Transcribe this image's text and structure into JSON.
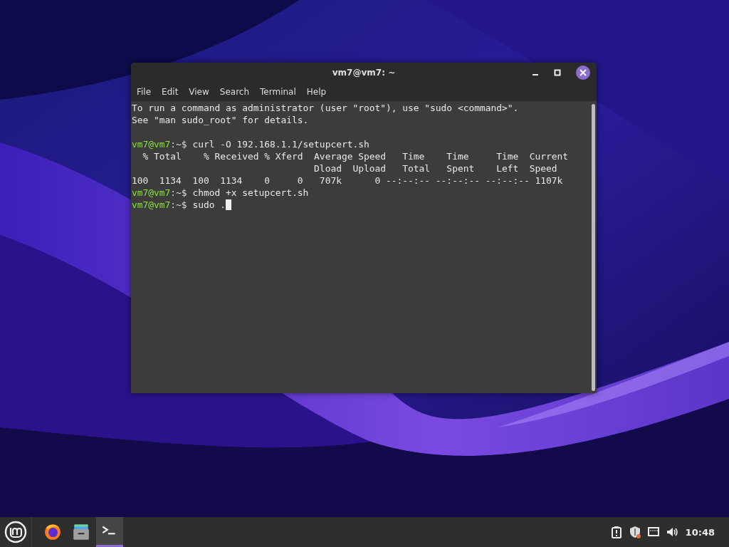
{
  "window": {
    "title": "vm7@vm7: ~"
  },
  "menu": [
    "File",
    "Edit",
    "View",
    "Search",
    "Terminal",
    "Help"
  ],
  "terminal": {
    "lines": [
      {
        "kind": "output",
        "text": "To run a command as administrator (user \"root\"), use \"sudo <command>\"."
      },
      {
        "kind": "output",
        "text": "See \"man sudo_root\" for details."
      },
      {
        "kind": "blank"
      },
      {
        "kind": "prompt",
        "user": "vm7@vm7",
        "path": ":~$ ",
        "command": "curl -O 192.168.1.1/setupcert.sh"
      },
      {
        "kind": "output",
        "text": "  % Total    % Received % Xferd  Average Speed   Time    Time     Time  Current"
      },
      {
        "kind": "output",
        "text": "                                 Dload  Upload   Total   Spent    Left  Speed"
      },
      {
        "kind": "output",
        "text": "100  1134  100  1134    0     0   707k      0 --:--:-- --:--:-- --:--:-- 1107k"
      },
      {
        "kind": "prompt",
        "user": "vm7@vm7",
        "path": ":~$ ",
        "command": "chmod +x setupcert.sh"
      },
      {
        "kind": "prompt",
        "user": "vm7@vm7",
        "path": ":~$ ",
        "command": "sudo .",
        "cursor": true
      }
    ]
  },
  "taskbar": {
    "launchers": [
      {
        "kind": "browser",
        "selected": false
      },
      {
        "kind": "files",
        "selected": false
      },
      {
        "kind": "terminal",
        "selected": true
      }
    ],
    "tray": [
      {
        "kind": "clipboard"
      },
      {
        "kind": "shield"
      },
      {
        "kind": "network"
      },
      {
        "kind": "volume"
      }
    ],
    "clock": "10:48"
  }
}
